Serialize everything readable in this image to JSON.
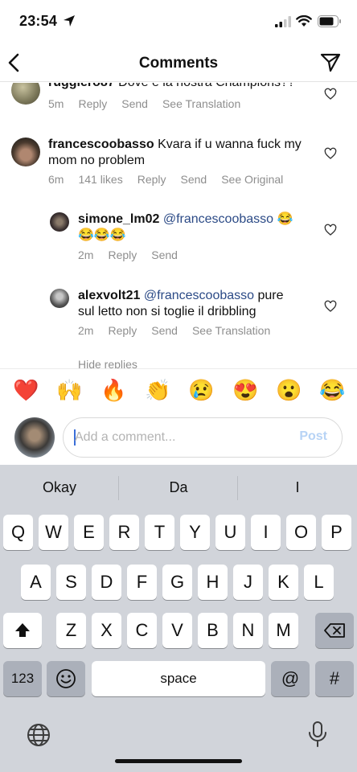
{
  "status_bar": {
    "time": "23:54"
  },
  "header": {
    "title": "Comments"
  },
  "comments": [
    {
      "user": "ruggiero87",
      "text": "Dove è la nostra Champions??",
      "time": "5m",
      "reply": "Reply",
      "send": "Send",
      "translate": "See Translation"
    },
    {
      "user": "francescoobasso",
      "text": "Kvara if u wanna fuck my mom no problem",
      "line1": "Kvara if u wanna fuck my",
      "line2": "mom no problem",
      "time": "6m",
      "likes": "141 likes",
      "reply": "Reply",
      "send": "Send",
      "translate": "See Original"
    },
    {
      "user": "simone_lm02",
      "mention": "@francescoobasso",
      "emoji_line": "😂😂😂",
      "emoji_end": "😂",
      "time": "2m",
      "reply": "Reply",
      "send": "Send"
    },
    {
      "user": "alexvolt21",
      "mention": "@francescoobasso",
      "text_end": "pure",
      "line2": "sul letto non si toglie il dribbling",
      "time": "2m",
      "reply": "Reply",
      "send": "Send",
      "translate": "See Translation"
    }
  ],
  "hide_replies": "Hide replies",
  "emoji_bar": [
    "❤️",
    "🙌",
    "🔥",
    "👏",
    "😢",
    "😍",
    "😮",
    "😂"
  ],
  "comment_input": {
    "placeholder": "Add a comment...",
    "post_label": "Post"
  },
  "keyboard": {
    "suggestions": [
      "Okay",
      "Da",
      "I"
    ],
    "row1": [
      "Q",
      "W",
      "E",
      "R",
      "T",
      "Y",
      "U",
      "I",
      "O",
      "P"
    ],
    "row2": [
      "A",
      "S",
      "D",
      "F",
      "G",
      "H",
      "J",
      "K",
      "L"
    ],
    "row3": [
      "Z",
      "X",
      "C",
      "V",
      "B",
      "N",
      "M"
    ],
    "numbers_label": "123",
    "space_label": "space",
    "at_label": "@",
    "hash_label": "#"
  },
  "colors": {
    "accent": "#0095f6",
    "post_disabled": "#b7d3f5",
    "mention": "#2b4a86",
    "like": "#ed4956"
  }
}
